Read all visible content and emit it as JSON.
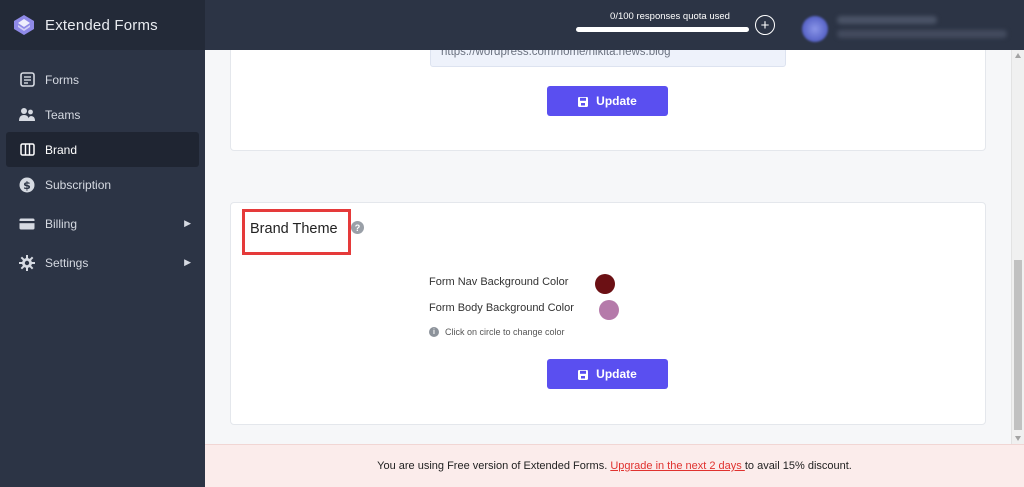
{
  "app": {
    "title": "Extended Forms"
  },
  "sidebar": {
    "items": [
      {
        "label": "Forms",
        "icon": "forms-icon"
      },
      {
        "label": "Teams",
        "icon": "teams-icon"
      },
      {
        "label": "Brand",
        "icon": "brand-icon",
        "active": true
      },
      {
        "label": "Subscription",
        "icon": "dollar-icon"
      },
      {
        "label": "Billing",
        "icon": "credit-card-icon",
        "caret": "▶"
      },
      {
        "label": "Settings",
        "icon": "gear-icon",
        "caret": "▶"
      }
    ]
  },
  "topbar": {
    "quota_label": "0/100 responses quota used",
    "quota_used_fraction": 0.0,
    "add_icon": "plus-circle-icon"
  },
  "domain_section": {
    "url_value": "https://wordpress.com/home/nikita.news.blog",
    "update_label": "Update"
  },
  "brand_theme": {
    "title": "Brand Theme",
    "help": "?",
    "nav_color_label": "Form Nav Background Color",
    "nav_color": "#6b1014",
    "body_color_label": "Form Body Background Color",
    "body_color": "#b57aaa",
    "hint": "Click on circle to change color",
    "update_label": "Update"
  },
  "footer": {
    "text_before": "You are using Free version of Extended Forms. ",
    "link_text": "Upgrade in the next 2 days ",
    "text_after": "to avail 15% discount."
  },
  "colors": {
    "sidebar_bg": "#2c3445",
    "accent": "#5a4ff0",
    "highlight": "#e53a3a"
  }
}
